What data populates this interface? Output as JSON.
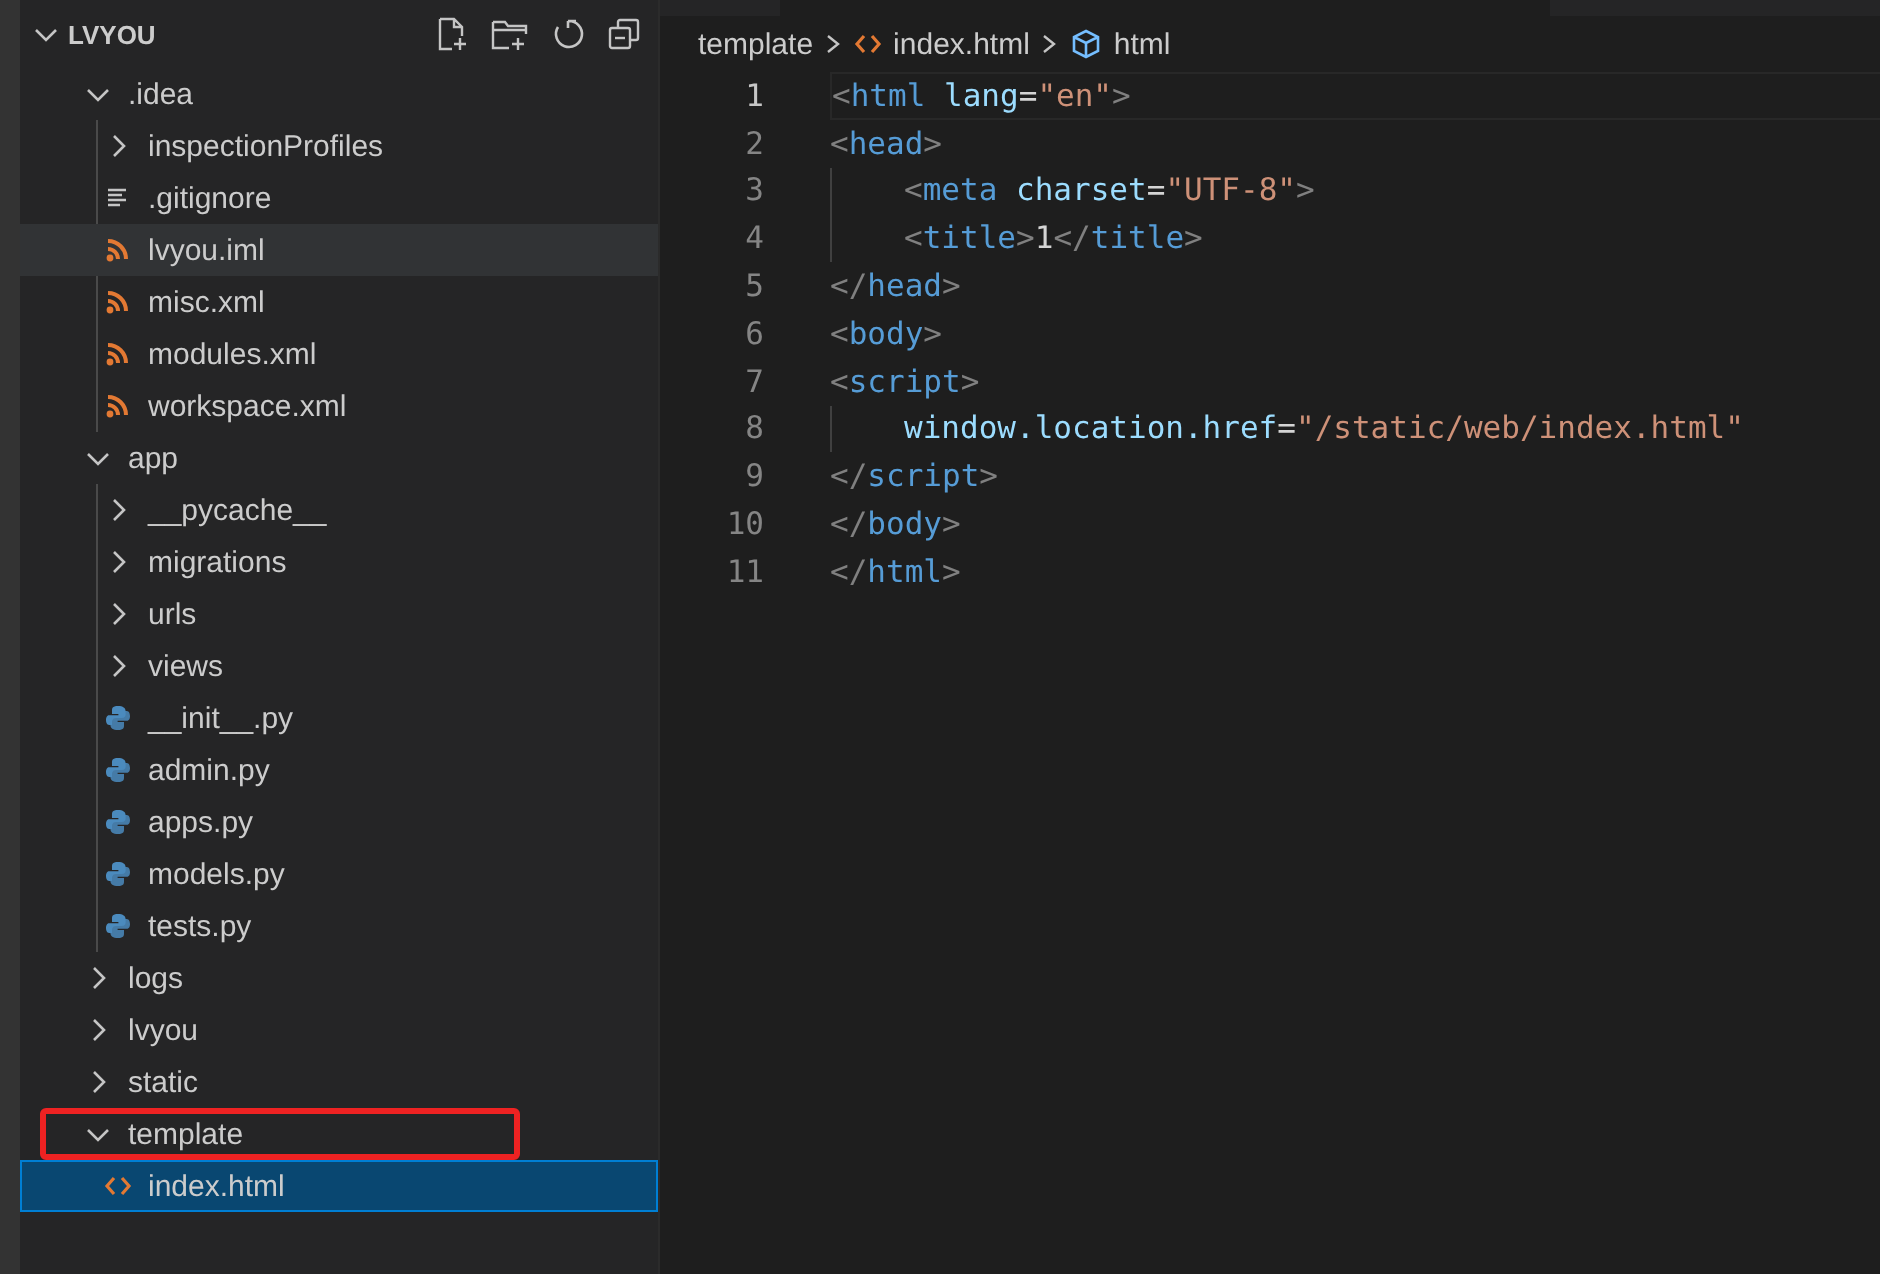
{
  "explorer": {
    "root": {
      "label": "LVYOU",
      "expanded": true
    },
    "items": [
      {
        "label": ".idea",
        "kind": "folder",
        "expanded": true,
        "selected": false,
        "hovered": false,
        "highlighted": false,
        "children": [
          {
            "label": "inspectionProfiles",
            "kind": "folder",
            "expanded": false,
            "selected": false,
            "hovered": false,
            "highlighted": false
          },
          {
            "label": ".gitignore",
            "kind": "text",
            "selected": false,
            "hovered": false,
            "highlighted": false
          },
          {
            "label": "lvyou.iml",
            "kind": "xml",
            "selected": false,
            "hovered": true,
            "highlighted": false
          },
          {
            "label": "misc.xml",
            "kind": "xml",
            "selected": false,
            "hovered": false,
            "highlighted": false
          },
          {
            "label": "modules.xml",
            "kind": "xml",
            "selected": false,
            "hovered": false,
            "highlighted": false
          },
          {
            "label": "workspace.xml",
            "kind": "xml",
            "selected": false,
            "hovered": false,
            "highlighted": false
          }
        ]
      },
      {
        "label": "app",
        "kind": "folder",
        "expanded": true,
        "selected": false,
        "hovered": false,
        "highlighted": false,
        "children": [
          {
            "label": "__pycache__",
            "kind": "folder",
            "expanded": false,
            "selected": false,
            "hovered": false,
            "highlighted": false
          },
          {
            "label": "migrations",
            "kind": "folder",
            "expanded": false,
            "selected": false,
            "hovered": false,
            "highlighted": false
          },
          {
            "label": "urls",
            "kind": "folder",
            "expanded": false,
            "selected": false,
            "hovered": false,
            "highlighted": false
          },
          {
            "label": "views",
            "kind": "folder",
            "expanded": false,
            "selected": false,
            "hovered": false,
            "highlighted": false
          },
          {
            "label": "__init__.py",
            "kind": "python",
            "selected": false,
            "hovered": false,
            "highlighted": false
          },
          {
            "label": "admin.py",
            "kind": "python",
            "selected": false,
            "hovered": false,
            "highlighted": false
          },
          {
            "label": "apps.py",
            "kind": "python",
            "selected": false,
            "hovered": false,
            "highlighted": false
          },
          {
            "label": "models.py",
            "kind": "python",
            "selected": false,
            "hovered": false,
            "highlighted": false
          },
          {
            "label": "tests.py",
            "kind": "python",
            "selected": false,
            "hovered": false,
            "highlighted": false
          }
        ]
      },
      {
        "label": "logs",
        "kind": "folder",
        "expanded": false,
        "selected": false,
        "hovered": false,
        "highlighted": false
      },
      {
        "label": "lvyou",
        "kind": "folder",
        "expanded": false,
        "selected": false,
        "hovered": false,
        "highlighted": false
      },
      {
        "label": "static",
        "kind": "folder",
        "expanded": false,
        "selected": false,
        "hovered": false,
        "highlighted": false
      },
      {
        "label": "template",
        "kind": "folder",
        "expanded": true,
        "selected": false,
        "hovered": false,
        "highlighted": true,
        "children": [
          {
            "label": "index.html",
            "kind": "html",
            "selected": true,
            "hovered": false,
            "highlighted": false
          }
        ]
      }
    ]
  },
  "breadcrumb": [
    {
      "label": "template",
      "kind": "folder"
    },
    {
      "label": "index.html",
      "kind": "html"
    },
    {
      "label": "html",
      "kind": "element"
    }
  ],
  "editor": {
    "lines": [
      {
        "number": "1",
        "current": true,
        "guide": false,
        "tokens": [
          {
            "kind": "punct",
            "text": "<"
          },
          {
            "kind": "tag",
            "text": "html "
          },
          {
            "kind": "attr",
            "text": "lang"
          },
          {
            "kind": "plain",
            "text": "="
          },
          {
            "kind": "str",
            "text": "\"en\""
          },
          {
            "kind": "punct",
            "text": ">"
          }
        ]
      },
      {
        "number": "2",
        "current": false,
        "guide": false,
        "tokens": [
          {
            "kind": "punct",
            "text": "<"
          },
          {
            "kind": "tag",
            "text": "head"
          },
          {
            "kind": "punct",
            "text": ">"
          }
        ]
      },
      {
        "number": "3",
        "current": false,
        "guide": true,
        "tokens": [
          {
            "kind": "punct",
            "text": "<"
          },
          {
            "kind": "tag",
            "text": "meta "
          },
          {
            "kind": "attr",
            "text": "charset"
          },
          {
            "kind": "plain",
            "text": "="
          },
          {
            "kind": "str",
            "text": "\"UTF-8\""
          },
          {
            "kind": "punct",
            "text": ">"
          }
        ]
      },
      {
        "number": "4",
        "current": false,
        "guide": true,
        "tokens": [
          {
            "kind": "punct",
            "text": "<"
          },
          {
            "kind": "tag",
            "text": "title"
          },
          {
            "kind": "punct",
            "text": ">"
          },
          {
            "kind": "plain",
            "text": "1"
          },
          {
            "kind": "punct",
            "text": "</"
          },
          {
            "kind": "tag",
            "text": "title"
          },
          {
            "kind": "punct",
            "text": ">"
          }
        ]
      },
      {
        "number": "5",
        "current": false,
        "guide": false,
        "tokens": [
          {
            "kind": "punct",
            "text": "</"
          },
          {
            "kind": "tag",
            "text": "head"
          },
          {
            "kind": "punct",
            "text": ">"
          }
        ]
      },
      {
        "number": "6",
        "current": false,
        "guide": false,
        "tokens": [
          {
            "kind": "punct",
            "text": "<"
          },
          {
            "kind": "tag",
            "text": "body"
          },
          {
            "kind": "punct",
            "text": ">"
          }
        ]
      },
      {
        "number": "7",
        "current": false,
        "guide": false,
        "tokens": [
          {
            "kind": "punct",
            "text": "<"
          },
          {
            "kind": "tag",
            "text": "script"
          },
          {
            "kind": "punct",
            "text": ">"
          }
        ]
      },
      {
        "number": "8",
        "current": false,
        "guide": true,
        "tokens": [
          {
            "kind": "attr",
            "text": "window.location.href"
          },
          {
            "kind": "plain",
            "text": "="
          },
          {
            "kind": "str",
            "text": "\"/static/web/index.html\""
          }
        ]
      },
      {
        "number": "9",
        "current": false,
        "guide": false,
        "tokens": [
          {
            "kind": "punct",
            "text": "</"
          },
          {
            "kind": "tag",
            "text": "script"
          },
          {
            "kind": "punct",
            "text": ">"
          }
        ]
      },
      {
        "number": "10",
        "current": false,
        "guide": false,
        "tokens": [
          {
            "kind": "punct",
            "text": "</"
          },
          {
            "kind": "tag",
            "text": "body"
          },
          {
            "kind": "punct",
            "text": ">"
          }
        ]
      },
      {
        "number": "11",
        "current": false,
        "guide": false,
        "tokens": [
          {
            "kind": "punct",
            "text": "</"
          },
          {
            "kind": "tag",
            "text": "html"
          },
          {
            "kind": "punct",
            "text": ">"
          }
        ]
      }
    ]
  }
}
